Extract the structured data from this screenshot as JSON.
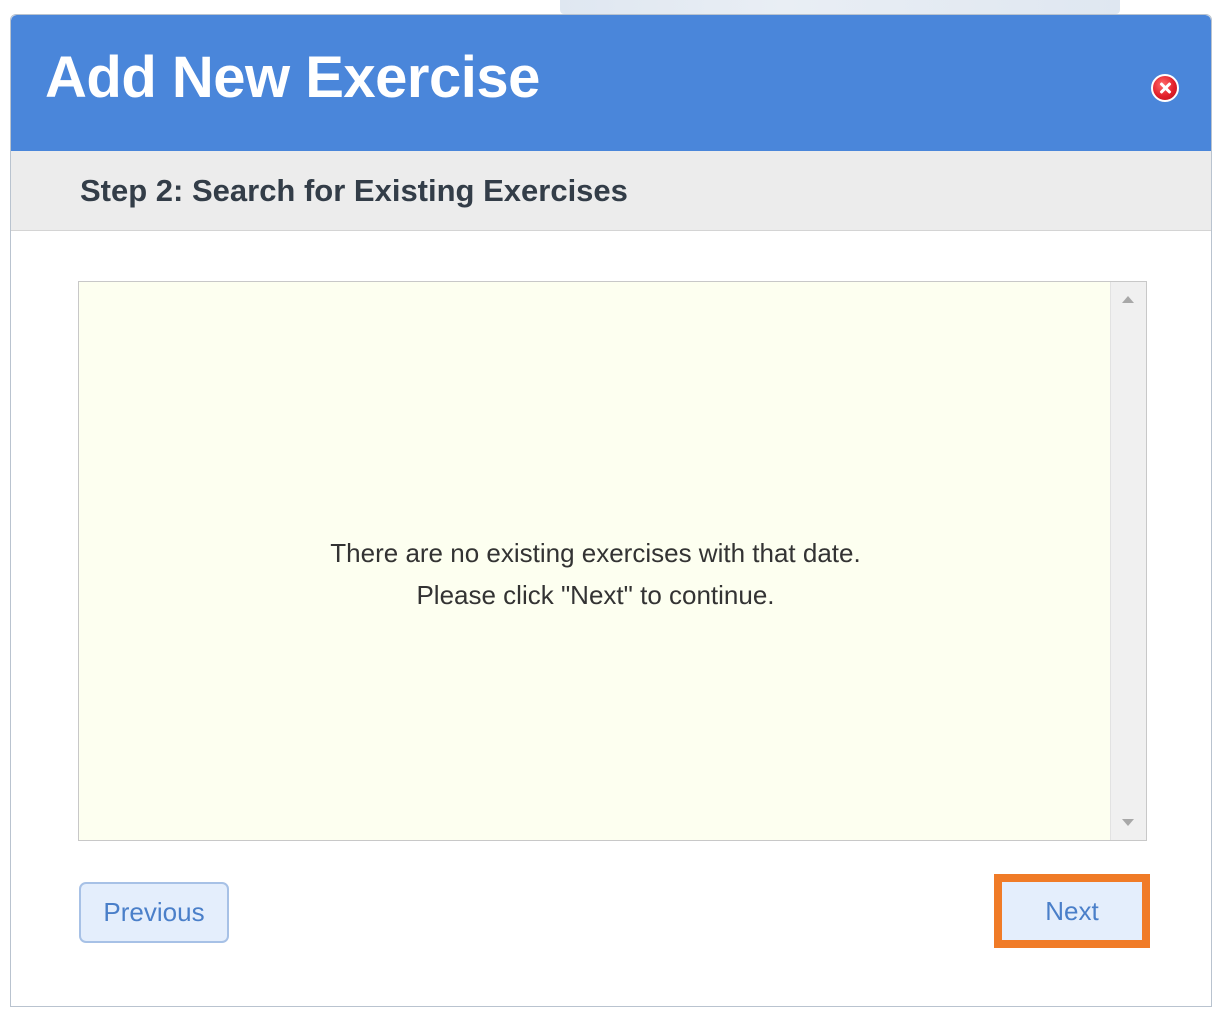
{
  "dialog": {
    "title": "Add New Exercise",
    "close_icon": "close-icon",
    "step": {
      "title": "Step 2: Search for Existing Exercises"
    },
    "results": {
      "message_line1": "There are no existing exercises with that date.",
      "message_line2": "Please click \"Next\" to continue."
    },
    "buttons": {
      "previous_label": "Previous",
      "next_label": "Next"
    }
  },
  "colors": {
    "titlebar": "#4a86da",
    "stepbar": "#ececec",
    "results_background": "#fdfff0",
    "button_background": "#e4eefc",
    "button_text": "#4a7fc9",
    "next_highlight": "#f07b27",
    "close_icon": "#e3202a"
  }
}
